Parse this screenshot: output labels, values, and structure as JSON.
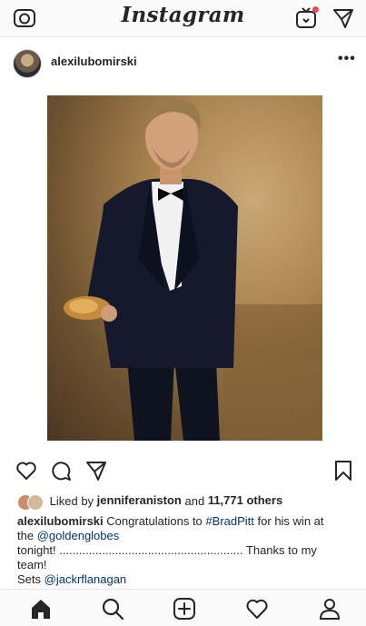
{
  "topbar": {
    "logo_text": "Instagram",
    "icons": [
      "camera-icon",
      "igtv-icon",
      "direct-send-icon"
    ],
    "notification_dot_color": "#ed4956"
  },
  "post": {
    "username": "alexilubomirski",
    "more_label": "•••",
    "photo_alt": "photo",
    "likes": {
      "prefix": "Liked by",
      "user": "jenniferaniston",
      "and": "and",
      "count_text": "11,771 others"
    },
    "caption": {
      "author": "alexilubomirski",
      "text1": "Congratulations to",
      "hashtag": "#BradPitt",
      "text2": "for his win at",
      "line2_prefix": "the",
      "mention1": "@goldenglobes",
      "line3": "tonight! ........................................................ Thanks to my",
      "line4": "team!",
      "line5_prefix": "Sets",
      "mention2": "@jackrflanagan"
    }
  },
  "colors": {
    "text": "#262626",
    "link": "#00376b",
    "separator": "#e6e6e6"
  },
  "bottom_nav": [
    "home-icon",
    "search-icon",
    "new-post-icon",
    "activity-heart-icon",
    "profile-icon"
  ]
}
